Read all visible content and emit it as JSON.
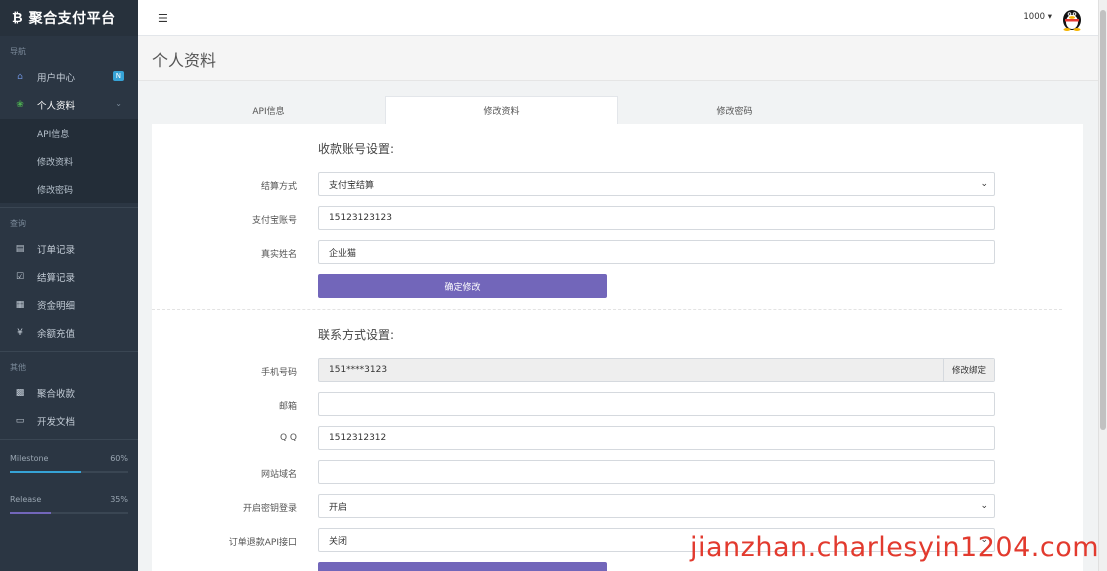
{
  "brand": {
    "logo": "₿",
    "name": "聚合支付平台"
  },
  "sidebar": {
    "nav_label": "导航",
    "items": [
      {
        "label": "用户中心",
        "badge": "N"
      },
      {
        "label": "个人资料"
      }
    ],
    "sub_items": [
      "API信息",
      "修改资料",
      "修改密码"
    ],
    "query_label": "查询",
    "query_items": [
      "订单记录",
      "结算记录",
      "资金明细",
      "余额充值"
    ],
    "other_label": "其他",
    "other_items": [
      "聚合收款",
      "开发文档"
    ],
    "progress": [
      {
        "label": "Milestone",
        "value": "60%",
        "fraction": 0.6,
        "color": "#36a3d6"
      },
      {
        "label": "Release",
        "value": "35%",
        "fraction": 0.35,
        "color": "#7266ba"
      }
    ]
  },
  "topbar": {
    "user": "1000 ▾"
  },
  "page": {
    "title": "个人资料"
  },
  "tabs": [
    "API信息",
    "修改资料",
    "修改密码"
  ],
  "payout": {
    "title": "收款账号设置:",
    "method_label": "结算方式",
    "method_value": "支付宝结算",
    "account_label": "支付宝账号",
    "account_value": "15123123123",
    "name_label": "真实姓名",
    "name_value": "企业猫",
    "submit": "确定修改"
  },
  "contact": {
    "title": "联系方式设置:",
    "phone_label": "手机号码",
    "phone_value": "151****3123",
    "phone_button": "修改绑定",
    "email_label": "邮箱",
    "email_value": "",
    "qq_label": "Q Q",
    "qq_value": "1512312312",
    "site_label": "网站域名",
    "site_value": "",
    "key_login_label": "开启密钥登录",
    "key_login_value": "开启",
    "refund_label": "订单退款API接口",
    "refund_value": "关闭"
  },
  "watermark": "jianzhan.charlesyin1204.com"
}
